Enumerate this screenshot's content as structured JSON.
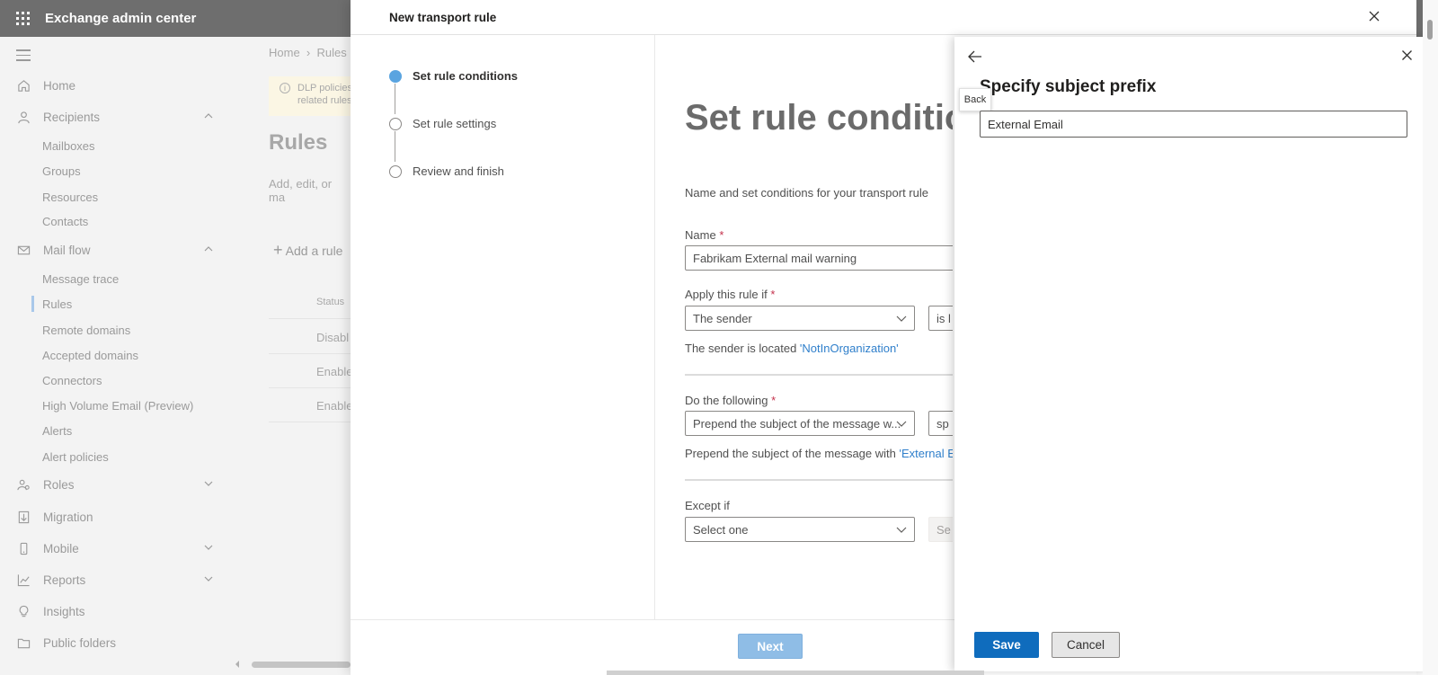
{
  "app": {
    "title": "Exchange admin center"
  },
  "nav": {
    "items": [
      {
        "label": "Home",
        "icon": "home-icon"
      },
      {
        "label": "Recipients",
        "icon": "person-icon",
        "expanded": true
      },
      {
        "label": "Mail flow",
        "icon": "mail-icon",
        "expanded": true
      },
      {
        "label": "Roles",
        "icon": "roles-icon"
      },
      {
        "label": "Migration",
        "icon": "migration-icon"
      },
      {
        "label": "Mobile",
        "icon": "mobile-icon"
      },
      {
        "label": "Reports",
        "icon": "reports-icon"
      },
      {
        "label": "Insights",
        "icon": "lightbulb-icon"
      },
      {
        "label": "Public folders",
        "icon": "folder-icon"
      }
    ],
    "recipients_sub": [
      "Mailboxes",
      "Groups",
      "Resources",
      "Contacts"
    ],
    "mailflow_sub": [
      "Message trace",
      "Rules",
      "Remote domains",
      "Accepted domains",
      "Connectors",
      "High Volume Email (Preview)",
      "Alerts",
      "Alert policies"
    ],
    "active_item": "Rules"
  },
  "main": {
    "breadcrumb_home": "Home",
    "breadcrumb_current": "Rules",
    "info_line1": "DLP policies",
    "info_line2": "related rules",
    "title": "Rules",
    "description": "Add, edit, or ma",
    "add_rule": "Add a rule",
    "col_status": "Status",
    "rows": [
      "Disabl",
      "Enable",
      "Enable"
    ]
  },
  "panel": {
    "title": "New transport rule",
    "steps": [
      {
        "label": "Set rule conditions",
        "active": true
      },
      {
        "label": "Set rule settings",
        "active": false
      },
      {
        "label": "Review and finish",
        "active": false
      }
    ],
    "heading": "Set rule conditio",
    "subtext": "Name and set conditions for your transport rule",
    "name_label": "Name",
    "name_value": "Fabrikam External mail warning",
    "apply_label": "Apply this rule if",
    "apply_value": "The sender",
    "apply_second": "is l",
    "apply_note_prefix": "The sender is located ",
    "apply_note_link": "'NotInOrganization'",
    "do_label": "Do the following",
    "do_value": "Prepend the subject of the message w...",
    "do_second": "sp",
    "do_note_prefix": "Prepend the subject of the message with ",
    "do_note_link": "'External Er",
    "except_label": "Except if",
    "except_value": "Select one",
    "except_second": "Se",
    "required_mark": "*",
    "next_label": "Next"
  },
  "flyout": {
    "title": "Specify subject prefix",
    "tooltip": "Back",
    "prefix_value": "External Email",
    "save_label": "Save",
    "cancel_label": "Cancel"
  },
  "colors": {
    "primary": "#0f6cbd",
    "link": "#2f7fcb",
    "required": "#c4314b",
    "topbar": "#6e6e6e"
  }
}
